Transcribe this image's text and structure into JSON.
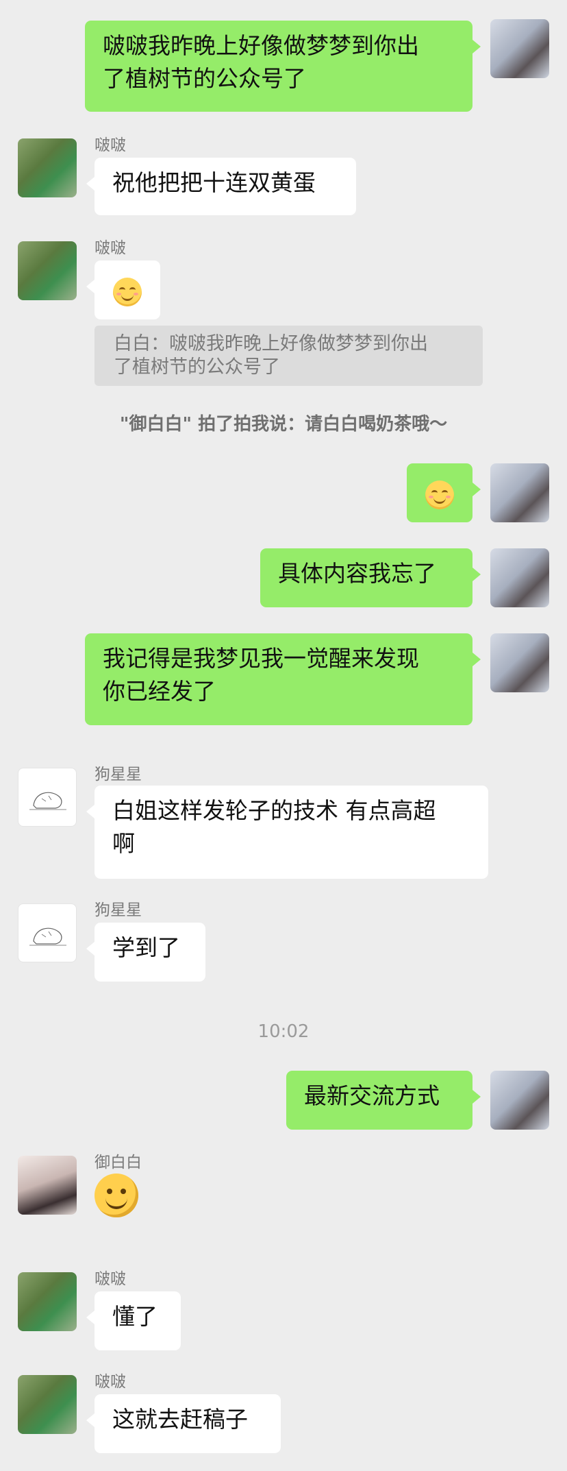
{
  "messages": [
    {
      "sender": "self",
      "text": "啵啵我昨晚上好像做梦梦到你出了植树节的公众号了"
    },
    {
      "sender": "啵啵",
      "text": "祝他把把十连双黄蛋"
    },
    {
      "sender": "啵啵",
      "emoji": "smiling-face-emoji"
    },
    {
      "sender": "self",
      "emoji": "smiling-face-emoji"
    },
    {
      "sender": "self",
      "text": "具体内容我忘了"
    },
    {
      "sender": "self",
      "text": "我记得是我梦见我一觉醒来发现你已经发了"
    },
    {
      "sender": "狗星星",
      "text": "白姐这样发轮子的技术 有点高超啊"
    },
    {
      "sender": "狗星星",
      "text": "学到了"
    },
    {
      "sender": "self",
      "text": "最新交流方式"
    },
    {
      "sender": "御白白",
      "sticker": "grinning-face-sticker"
    },
    {
      "sender": "啵啵",
      "text": "懂了"
    },
    {
      "sender": "啵啵",
      "text": "这就去赶稿子"
    }
  ],
  "names": {
    "bobo": "啵啵",
    "gou": "狗星星",
    "yu": "御白白"
  },
  "texts": {
    "m1_l1": "啵啵我昨晚上好像做梦梦到你出",
    "m1_l2": "了植树节的公众号了",
    "m2": "祝他把把十连双黄蛋",
    "quote_l1": "白白：啵啵我昨晚上好像做梦梦到你出",
    "quote_l2": "了植树节的公众号了",
    "system_pat": "\"御白白\" 拍了拍我说：请白白喝奶茶哦～",
    "m5": "具体内容我忘了",
    "m6_l1": "我记得是我梦见我一觉醒来发现",
    "m6_l2": "你已经发了",
    "m7_l1": "白姐这样发轮子的技术 有点高超",
    "m7_l2": "啊",
    "m8": "学到了",
    "timestamp": "10:02",
    "m9": "最新交流方式",
    "m11": "懂了",
    "m12": "这就去赶稿子"
  },
  "colors": {
    "background": "#ededed",
    "self_bubble": "#95ec69",
    "other_bubble": "#ffffff",
    "quote_bg": "#dcdcdc"
  }
}
